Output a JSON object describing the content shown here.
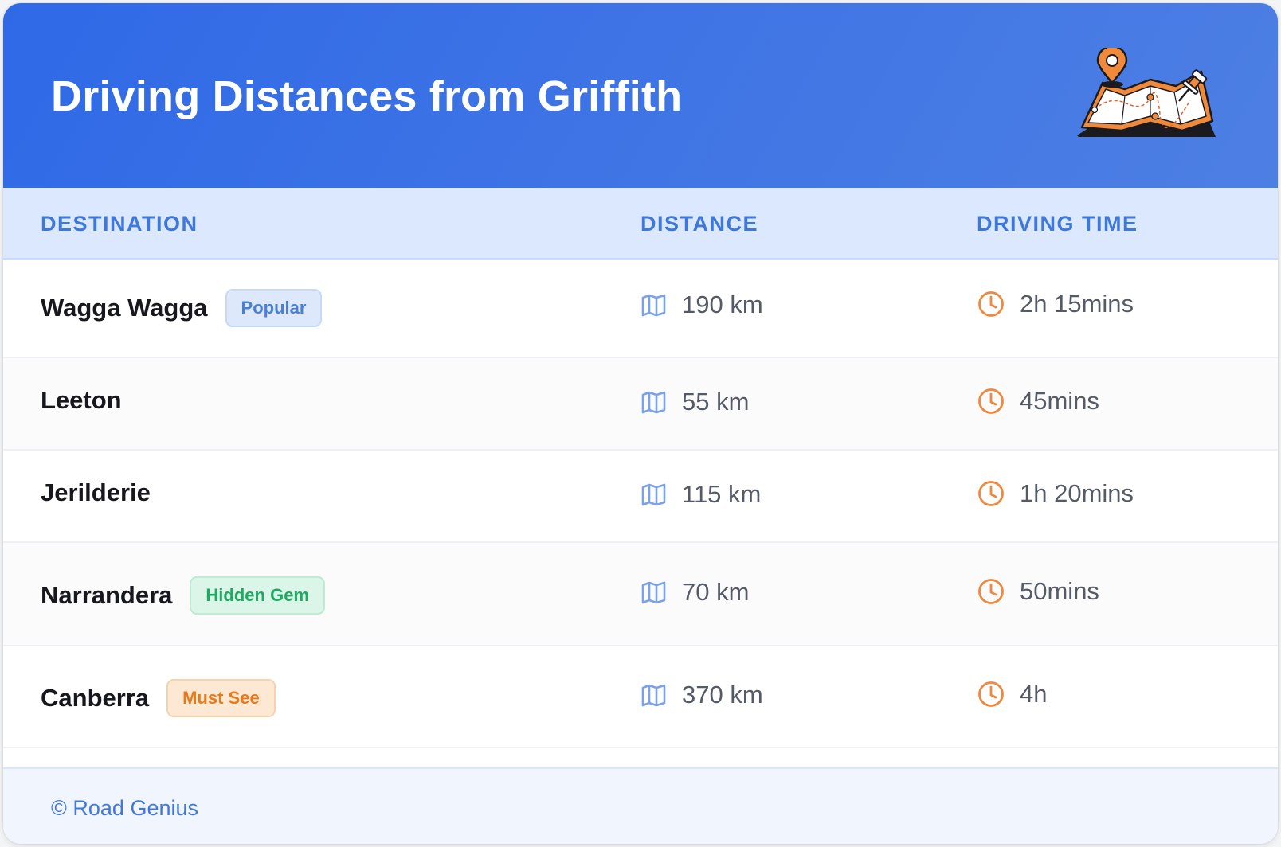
{
  "header": {
    "title": "Driving Distances from Griffith",
    "illustration_icon": "map-with-pins-icon"
  },
  "table": {
    "columns": [
      "DESTINATION",
      "DISTANCE",
      "DRIVING TIME"
    ],
    "rows": [
      {
        "destination": "Wagga Wagga",
        "badge": "Popular",
        "badge_style": "blue",
        "distance": "190 km",
        "time": "2h 15mins"
      },
      {
        "destination": "Leeton",
        "badge": "",
        "badge_style": "",
        "distance": "55 km",
        "time": "45mins"
      },
      {
        "destination": "Jerilderie",
        "badge": "",
        "badge_style": "",
        "distance": "115 km",
        "time": "1h 20mins"
      },
      {
        "destination": "Narrandera",
        "badge": "Hidden Gem",
        "badge_style": "green",
        "distance": "70 km",
        "time": "50mins"
      },
      {
        "destination": "Canberra",
        "badge": "Must See",
        "badge_style": "orange",
        "distance": "370 km",
        "time": "4h"
      }
    ]
  },
  "icons": {
    "distance": "map-icon",
    "time": "clock-icon"
  },
  "colors": {
    "header_gradient_start": "#2f69e6",
    "header_gradient_end": "#4d7fe3",
    "accent_blue": "#3f78dc",
    "icon_orange": "#f0883e",
    "badge_popular": "#4a7fd6",
    "badge_hidden_gem": "#1eaa63",
    "badge_must_see": "#e87a1c"
  },
  "footer": {
    "text": "© Road Genius"
  }
}
